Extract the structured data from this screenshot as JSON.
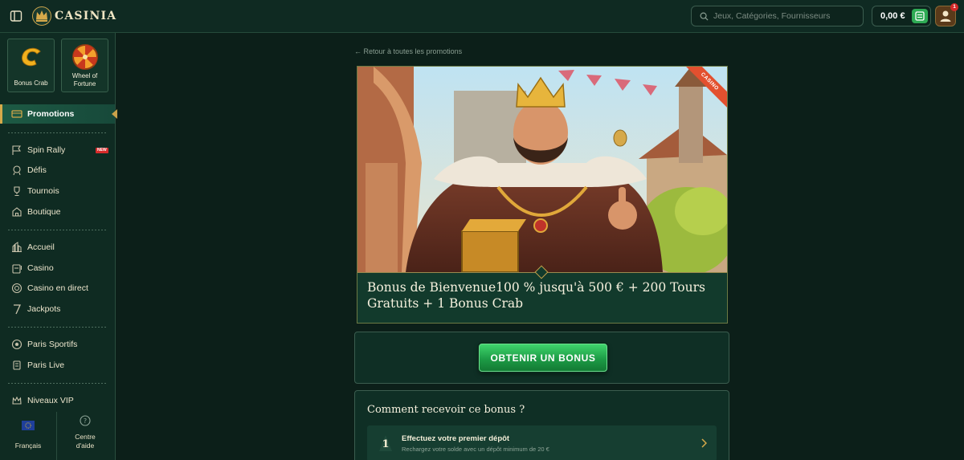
{
  "header": {
    "logo_text": "CASINIA",
    "search_placeholder": "Jeux, Catégories, Fournisseurs",
    "balance": "0,00 €",
    "notification_count": "1"
  },
  "sidebar": {
    "quick_cards": [
      {
        "label": "Bonus Crab"
      },
      {
        "label": "Wheel of Fortune"
      }
    ],
    "active_item": "Promotions",
    "group1": [
      "Spin Rally",
      "Défis",
      "Tournois",
      "Boutique"
    ],
    "new_badge": "NEW",
    "group2": [
      "Accueil",
      "Casino",
      "Casino en direct",
      "Jackpots"
    ],
    "group3": [
      "Paris Sportifs",
      "Paris Live"
    ],
    "vip": "Niveaux VIP",
    "language": "Français",
    "help": "Centre d'aide"
  },
  "main": {
    "back_link": "Retour à toutes les promotions",
    "ribbon": "CASINO",
    "promo_title": "Bonus de Bienvenue100 % jusqu'à 500 € + 200 Tours Gratuits + 1 Bonus Crab",
    "cta": "OBTENIR UN BONUS",
    "how_title": "Comment recevoir ce bonus ?",
    "steps": [
      {
        "number": "1",
        "title": "Effectuez votre premier dépôt",
        "subtitle": "Rechargez votre solde avec un dépôt minimum de 20 €"
      }
    ]
  },
  "colors": {
    "background": "#0c1f19",
    "sidebar": "#0f2b22",
    "accent_gold": "#d6a94a",
    "cta_green": "#2eaa54",
    "ribbon_red": "#e3502f"
  }
}
